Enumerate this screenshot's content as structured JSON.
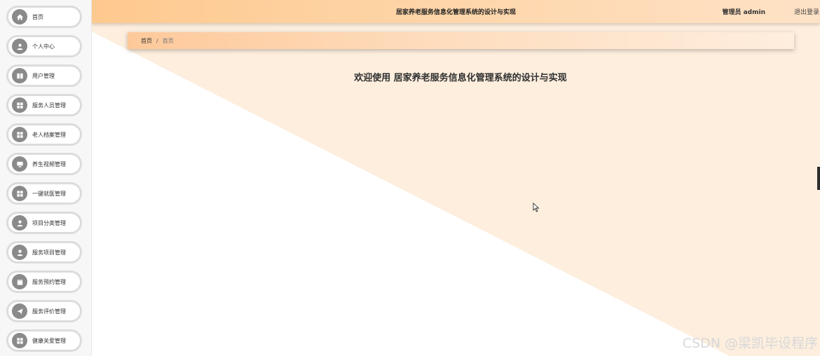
{
  "app": {
    "title": "居家养老服务信息化管理系统的设计与实现",
    "user": "管理员 admin",
    "logout": "退出登录"
  },
  "breadcrumb": {
    "home": "首页",
    "separator": "/",
    "current": "首页"
  },
  "welcome": "欢迎使用 居家养老服务信息化管理系统的设计与实现",
  "sidebar": {
    "items": [
      {
        "label": "首页",
        "icon": "home-icon"
      },
      {
        "label": "个人中心",
        "icon": "user-icon"
      },
      {
        "label": "用户管理",
        "icon": "book-icon"
      },
      {
        "label": "服务人员管理",
        "icon": "grid-icon"
      },
      {
        "label": "老人档案管理",
        "icon": "grid-icon"
      },
      {
        "label": "养生视频管理",
        "icon": "screen-icon"
      },
      {
        "label": "一键就医管理",
        "icon": "grid-icon"
      },
      {
        "label": "项目分类管理",
        "icon": "user-icon"
      },
      {
        "label": "服务项目管理",
        "icon": "user-icon"
      },
      {
        "label": "服务预约管理",
        "icon": "calendar-icon"
      },
      {
        "label": "服务评价管理",
        "icon": "send-icon"
      },
      {
        "label": "健康关爱管理",
        "icon": "grid-icon"
      }
    ]
  },
  "watermark": "CSDN @梁凯毕设程序",
  "colors": {
    "accent": "#fec98f",
    "background_peach": "#fdeedd",
    "menu_icon": "#8a8a8a",
    "menu_border": "#dcdcdc"
  }
}
